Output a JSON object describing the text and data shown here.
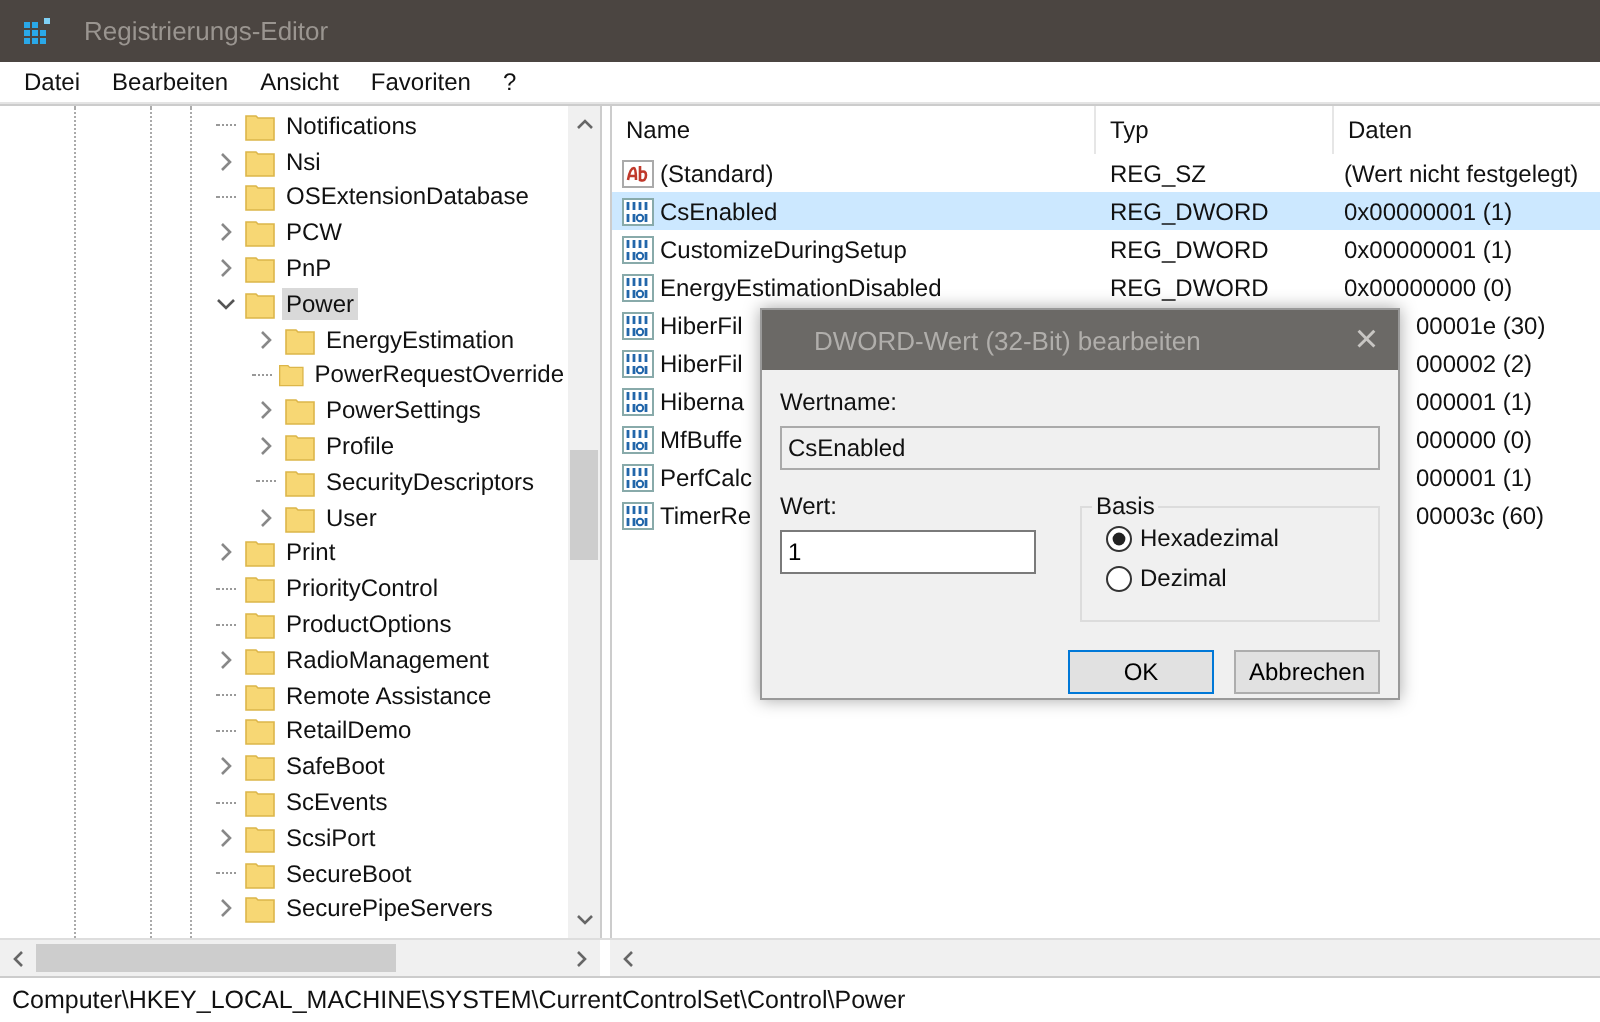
{
  "window": {
    "title": "Registrierungs-Editor"
  },
  "menu": [
    "Datei",
    "Bearbeiten",
    "Ansicht",
    "Favoriten",
    "?"
  ],
  "tree": [
    {
      "label": "Notifications",
      "expandable": false,
      "selected": false
    },
    {
      "label": "Nsi",
      "expandable": true,
      "expanded": false,
      "selected": false
    },
    {
      "label": "OSExtensionDatabase",
      "expandable": false,
      "selected": false
    },
    {
      "label": "PCW",
      "expandable": true,
      "expanded": false,
      "selected": false
    },
    {
      "label": "PnP",
      "expandable": true,
      "expanded": false,
      "selected": false
    },
    {
      "label": "Power",
      "expandable": true,
      "expanded": true,
      "selected": true,
      "children": [
        {
          "label": "EnergyEstimation",
          "expandable": true,
          "expanded": false,
          "selected": false
        },
        {
          "label": "PowerRequestOverride",
          "expandable": false,
          "selected": false
        },
        {
          "label": "PowerSettings",
          "expandable": true,
          "expanded": false,
          "selected": false
        },
        {
          "label": "Profile",
          "expandable": true,
          "expanded": false,
          "selected": false
        },
        {
          "label": "SecurityDescriptors",
          "expandable": false,
          "selected": false
        },
        {
          "label": "User",
          "expandable": true,
          "expanded": false,
          "selected": false
        }
      ]
    },
    {
      "label": "Print",
      "expandable": true,
      "expanded": false,
      "selected": false
    },
    {
      "label": "PriorityControl",
      "expandable": false,
      "selected": false
    },
    {
      "label": "ProductOptions",
      "expandable": false,
      "selected": false
    },
    {
      "label": "RadioManagement",
      "expandable": true,
      "expanded": false,
      "selected": false
    },
    {
      "label": "Remote Assistance",
      "expandable": false,
      "selected": false
    },
    {
      "label": "RetailDemo",
      "expandable": false,
      "selected": false
    },
    {
      "label": "SafeBoot",
      "expandable": true,
      "expanded": false,
      "selected": false
    },
    {
      "label": "ScEvents",
      "expandable": false,
      "selected": false
    },
    {
      "label": "ScsiPort",
      "expandable": true,
      "expanded": false,
      "selected": false
    },
    {
      "label": "SecureBoot",
      "expandable": false,
      "selected": false
    },
    {
      "label": "SecurePipeServers",
      "expandable": true,
      "expanded": false,
      "selected": false
    }
  ],
  "table": {
    "columns": [
      "Name",
      "Typ",
      "Daten"
    ],
    "rows": [
      {
        "kind": "string",
        "name": "(Standard)",
        "type": "REG_SZ",
        "data": "(Wert nicht festgelegt)",
        "selected": false
      },
      {
        "kind": "dword",
        "name": "CsEnabled",
        "type": "REG_DWORD",
        "data": "0x00000001 (1)",
        "selected": true
      },
      {
        "kind": "dword",
        "name": "CustomizeDuringSetup",
        "type": "REG_DWORD",
        "data": "0x00000001 (1)",
        "selected": false
      },
      {
        "kind": "dword",
        "name": "EnergyEstimationDisabled",
        "type": "REG_DWORD",
        "data": "0x00000000 (0)",
        "selected": false
      },
      {
        "kind": "dword",
        "name": "HiberFil",
        "data": "00001e (30)",
        "selected": false
      },
      {
        "kind": "dword",
        "name": "HiberFil",
        "data": "000002 (2)",
        "selected": false
      },
      {
        "kind": "dword",
        "name": "Hiberna",
        "data": "000001 (1)",
        "selected": false
      },
      {
        "kind": "dword",
        "name": "MfBuffe",
        "data": "000000 (0)",
        "selected": false
      },
      {
        "kind": "dword",
        "name": "PerfCalc",
        "data": "000001 (1)",
        "selected": false
      },
      {
        "kind": "dword",
        "name": "TimerRe",
        "data": "00003c (60)",
        "selected": false
      }
    ]
  },
  "dialog": {
    "title": "DWORD-Wert (32-Bit) bearbeiten",
    "close": "×",
    "name_label": "Wertname:",
    "name_value": "CsEnabled",
    "value_label": "Wert:",
    "value": "1",
    "base_label": "Basis",
    "bases": [
      {
        "label": "Hexadezimal",
        "selected": true
      },
      {
        "label": "Dezimal",
        "selected": false
      }
    ],
    "buttons": [
      {
        "label": "OK",
        "default": true
      },
      {
        "label": "Abbrechen",
        "default": false
      }
    ]
  },
  "status_bar": "Computer\\HKEY_LOCAL_MACHINE\\SYSTEM\\CurrentControlSet\\Control\\Power"
}
